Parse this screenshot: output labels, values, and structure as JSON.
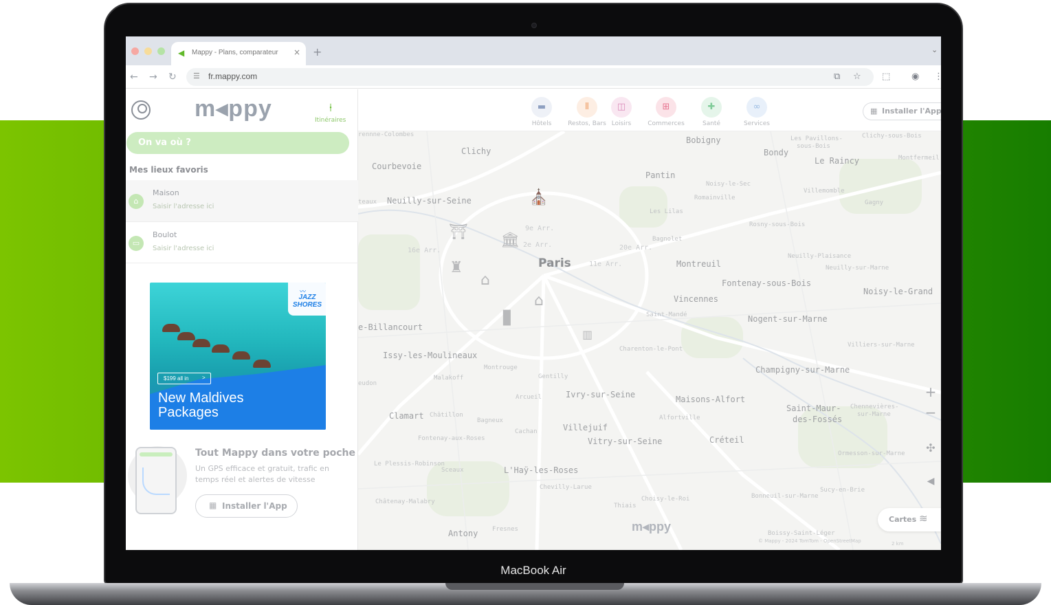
{
  "device": {
    "label": "MacBook Air"
  },
  "browser": {
    "tab_title": "Mappy - Plans, comparateur",
    "tab_close": "×",
    "new_tab": "+",
    "url": "fr.mappy.com"
  },
  "sidebar": {
    "logo": "m◂ppy",
    "itineraires_label": "Itinéraires",
    "search_placeholder": "On va où ?",
    "favorites_title": "Mes lieux favoris",
    "favorites": [
      {
        "name": "Maison",
        "hint": "Saisir l'adresse ici",
        "icon": "home-icon"
      },
      {
        "name": "Boulot",
        "hint": "Saisir l'adresse ici",
        "icon": "briefcase-icon"
      }
    ],
    "ad": {
      "brand_line1": "JAZZ",
      "brand_line2": "SHORES",
      "cta": "$199 all in",
      "cta_arrow": ">",
      "headline_line1": "New Maldives",
      "headline_line2": "Packages"
    },
    "app_promo": {
      "title": "Tout Mappy dans votre poche",
      "description": "Un GPS efficace et gratuit, trafic en temps réel et alertes de vitesse",
      "button": "Installer l'App"
    }
  },
  "topnav": {
    "categories": [
      {
        "label": "Hôtels",
        "icon": "bed-icon",
        "color": "#7b8fb3"
      },
      {
        "label": "Restos, Bars",
        "icon": "fork-knife-icon",
        "color": "#e98a4a"
      },
      {
        "label": "Loisirs",
        "icon": "ticket-icon",
        "color": "#d26aa6"
      },
      {
        "label": "Commerces",
        "icon": "shop-icon",
        "color": "#e04e6e"
      },
      {
        "label": "Santé",
        "icon": "cross-icon",
        "color": "#5fbe7e"
      },
      {
        "label": "Services",
        "icon": "car-icon",
        "color": "#7ea8d8"
      }
    ],
    "install_button": "Installer l'App"
  },
  "map": {
    "city": "Paris",
    "labels": {
      "colombes": "rennne-Colombes",
      "clichy": "Clichy",
      "bobigny": "Bobigny",
      "bondy": "Bondy",
      "pavillons": "Les Pavillons-",
      "pavillons2": "sous-Bois",
      "raincy": "Le Raincy",
      "clichy_sous_bois": "Clichy-sous-Bois",
      "montfermeil": "Montfermeil",
      "courbevoie": "Courbevoie",
      "pantin": "Pantin",
      "noisy_le_sec": "Noisy-le-Sec",
      "romainville": "Romainville",
      "villemomble": "Villemomble",
      "gagny": "Gagny",
      "neuilly": "Neuilly-sur-Seine",
      "teaux": "teaux",
      "lilas": "Les Lilas",
      "rosny": "Rosny-sous-Bois",
      "bagnolet": "Bagnolet",
      "arr9": "9e Arr.",
      "arr2": "2e Arr.",
      "arr16": "16e Arr.",
      "arr20": "20e Arr.",
      "arr11": "11e Arr.",
      "montreuil": "Montreuil",
      "neuilly_plaisance": "Neuilly-Plaisance",
      "neuilly_marne": "Neuilly-sur-Marne",
      "fontenay_bois": "Fontenay-sous-Bois",
      "noisy_grand": "Noisy-le-Grand",
      "vincennes": "Vincennes",
      "saint_mande": "Saint-Mandé",
      "nogent": "Nogent-sur-Marne",
      "billancourt": "e-Billancourt",
      "charenton": "Charenton-le-Pont",
      "villiers": "Villiers-sur-Marne",
      "issy": "Issy-les-Moulineaux",
      "montrouge": "Montrouge",
      "gentilly": "Gentilly",
      "champigny": "Champigny-sur-Marne",
      "malakoff": "Malakoff",
      "meudon": "eudon",
      "ivry": "Ivry-sur-Seine",
      "arcueil": "Arcueil",
      "maisons_alfort": "Maisons-Alfort",
      "clamart": "Clamart",
      "chatillon": "Châtillon",
      "bagneux": "Bagneux",
      "st_maur": "Saint-Maur-",
      "st_maur2": "des-Fossés",
      "chennevieres": "Chennevières-",
      "chennevieres2": "sur-Marne",
      "alfortville": "Alfortville",
      "cachan": "Cachan",
      "villejuif": "Villejuif",
      "fontenay_roses": "Fontenay-aux-Roses",
      "vitry": "Vitry-sur-Seine",
      "creteil": "Créteil",
      "ormesson": "Ormesson-sur-Marne",
      "plessis": "Le Plessis-Robinson",
      "sceaux": "Sceaux",
      "hay": "L'Haÿ-les-Roses",
      "chevilly": "Chevilly-Larue",
      "bonneuil": "Bonneuil-sur-Marne",
      "sucy": "Sucy-en-Brie",
      "chatenay": "Châtenay-Malabry",
      "thiais": "Thiais",
      "choisy": "Choisy-le-Roi",
      "antony": "Antony",
      "fresnes": "Fresnes",
      "boissy": "Boissy-Saint-Léger"
    },
    "cartes_button": "Cartes",
    "copyright": "© Mappy - 2024 TomTom - OpenStreetMap",
    "scale": "2 km",
    "zoom_in": "+",
    "zoom_out": "−"
  }
}
